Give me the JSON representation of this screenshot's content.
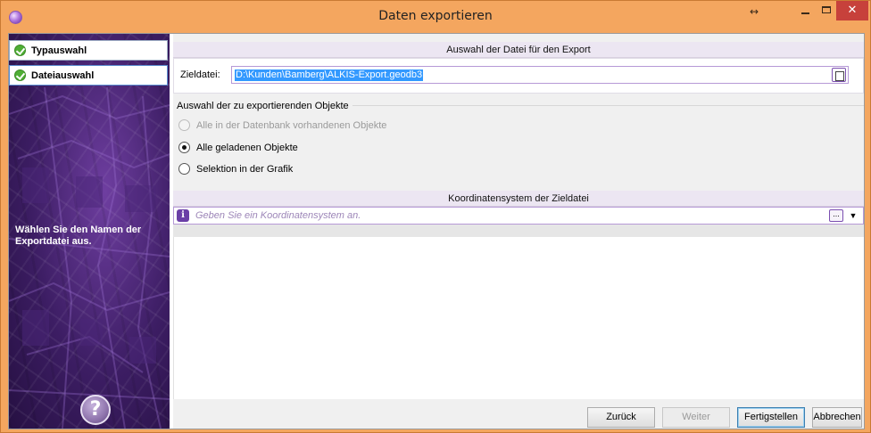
{
  "window": {
    "title": "Daten exportieren",
    "close_glyph": "✕",
    "resize_glyph": "↔",
    "colors": {
      "frame": "#f4a65f",
      "close": "#c7413b",
      "accent": "#7b4fb0"
    }
  },
  "wizard": {
    "steps": [
      {
        "label": "Typauswahl",
        "done": true
      },
      {
        "label": "Dateiauswahl",
        "done": true,
        "active": true
      }
    ],
    "hint": "Wählen Sie den Namen der Exportdatei aus.",
    "help_glyph": "?"
  },
  "file_section": {
    "header": "Auswahl der Datei für den Export",
    "label": "Zieldatei:",
    "value": "D:\\Kunden\\Bamberg\\ALKIS-Export.geodb3"
  },
  "objects_section": {
    "legend": "Auswahl der zu exportierenden Objekte",
    "options": [
      {
        "label": "Alle in der Datenbank vorhandenen Objekte",
        "selected": false,
        "enabled": false
      },
      {
        "label": "Alle geladenen Objekte",
        "selected": true,
        "enabled": true
      },
      {
        "label": "Selektion in der Grafik",
        "selected": false,
        "enabled": true
      }
    ]
  },
  "crs_section": {
    "header": "Koordinatensystem der Zieldatei",
    "placeholder": "Geben Sie ein Koordinatensystem an.",
    "info_glyph": "i",
    "browse_glyph": "...",
    "dropdown_glyph": "▼"
  },
  "buttons": {
    "back": "Zurück",
    "next": "Weiter",
    "finish": "Fertigstellen",
    "cancel": "Abbrechen"
  }
}
